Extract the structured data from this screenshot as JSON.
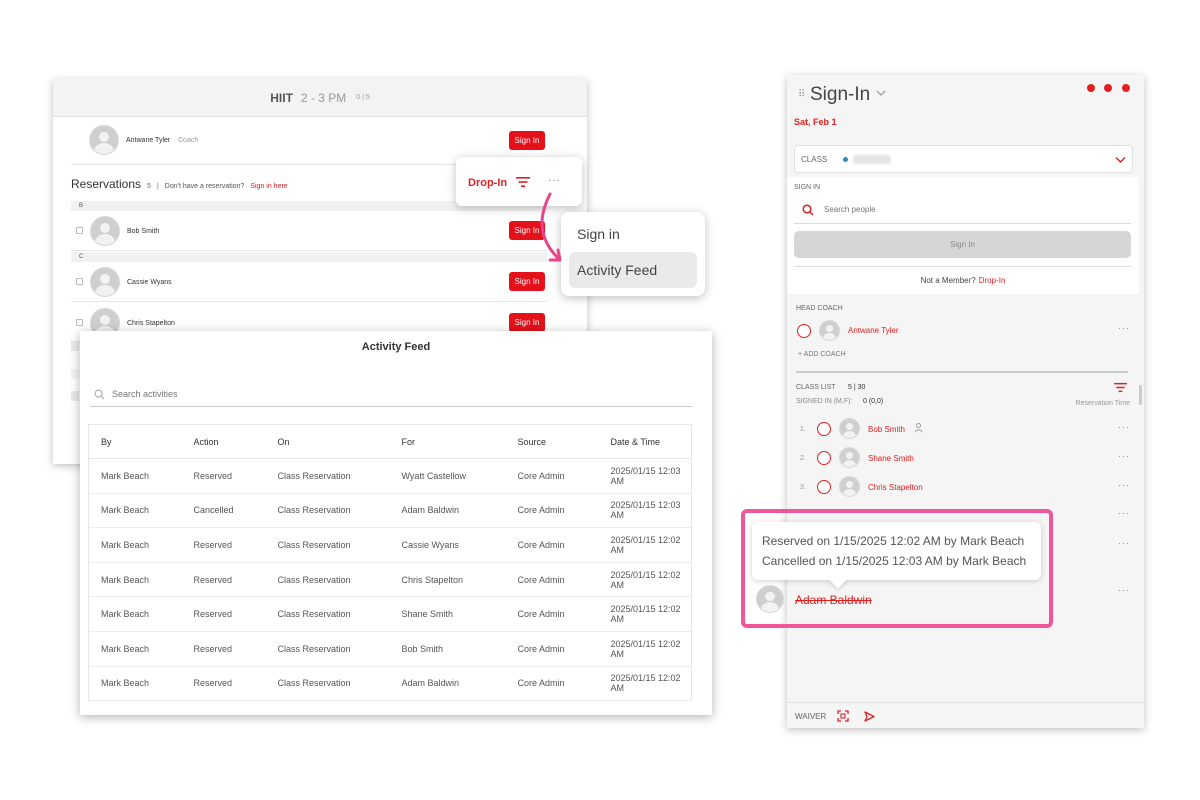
{
  "left_panel": {
    "class_name": "HIIT",
    "class_time": "2 - 3 PM",
    "class_count": "0 | 5",
    "coach": {
      "name": "Antwane Tyler",
      "role": "Coach",
      "button": "Sign In"
    },
    "reservations": {
      "title": "Reservations",
      "count": "5",
      "separator": "|",
      "no_reservation": "Don't have a reservation?",
      "sign_in_link": "Sign in here"
    },
    "groups": [
      {
        "letter": "B",
        "name": "Bob Smith",
        "button": "Sign In"
      },
      {
        "letter": "C",
        "name": "Cassie Wyans",
        "button": "Sign In"
      },
      {
        "letter": "",
        "name": "Chris Stapelton",
        "button": "Sign In"
      }
    ]
  },
  "dropin_popover": {
    "label": "Drop-In",
    "filter_icon": "filter-icon",
    "more_icon": "more-dots-icon",
    "more_text": "···"
  },
  "context_menu": {
    "items": [
      "Sign in",
      "Activity Feed"
    ]
  },
  "activity_feed": {
    "title": "Activity Feed",
    "search_placeholder": "Search activities",
    "columns": [
      "By",
      "Action",
      "On",
      "For",
      "Source",
      "Date & Time"
    ],
    "rows": [
      [
        "Mark Beach",
        "Reserved",
        "Class Reservation",
        "Wyatt Castellow",
        "Core Admin",
        "2025/01/15 12:03 AM"
      ],
      [
        "Mark Beach",
        "Cancelled",
        "Class Reservation",
        "Adam Baldwin",
        "Core Admin",
        "2025/01/15 12:03 AM"
      ],
      [
        "Mark Beach",
        "Reserved",
        "Class Reservation",
        "Cassie Wyans",
        "Core Admin",
        "2025/01/15 12:02 AM"
      ],
      [
        "Mark Beach",
        "Reserved",
        "Class Reservation",
        "Chris Stapelton",
        "Core Admin",
        "2025/01/15 12:02 AM"
      ],
      [
        "Mark Beach",
        "Reserved",
        "Class Reservation",
        "Shane Smith",
        "Core Admin",
        "2025/01/15 12:02 AM"
      ],
      [
        "Mark Beach",
        "Reserved",
        "Class Reservation",
        "Bob Smith",
        "Core Admin",
        "2025/01/15 12:02 AM"
      ],
      [
        "Mark Beach",
        "Reserved",
        "Class Reservation",
        "Adam Baldwin",
        "Core Admin",
        "2025/01/15 12:02 AM"
      ]
    ]
  },
  "right_panel": {
    "drag_handle": "⠿",
    "title": "Sign-In",
    "date": "Sat, Feb 1",
    "class_label": "CLASS",
    "signin_label": "SIGN IN",
    "search_placeholder": "Search people",
    "signin_button": "Sign In",
    "not_member": "Not a Member?",
    "dropin_link": "Drop-In",
    "head_coach_label": "HEAD COACH",
    "head_coach_name": "Antwane Tyler",
    "add_coach": "+ ADD COACH",
    "class_list_label": "CLASS LIST",
    "class_list_count": "5 | 30",
    "signed_in_label": "SIGNED IN (M,F):",
    "signed_in_value": "0 (0,0)",
    "reservation_time": "Reservation Time",
    "members": [
      {
        "num": "1.",
        "name": "Bob Smith"
      },
      {
        "num": "2.",
        "name": "Shane Smith"
      },
      {
        "num": "3.",
        "name": "Chris Stapelton"
      }
    ],
    "row_dots": "···",
    "waiver_label": "WAIVER",
    "colors": {
      "accent": "#e02020",
      "highlight": "#f0579a",
      "class_dot": "#2a8fb8"
    }
  },
  "tooltip": {
    "line1": "Reserved on 1/15/2025 12:02 AM by Mark Beach",
    "line2": "Cancelled on 1/15/2025 12:03 AM by Mark Beach",
    "removed_name": "Adam Baldwin"
  }
}
